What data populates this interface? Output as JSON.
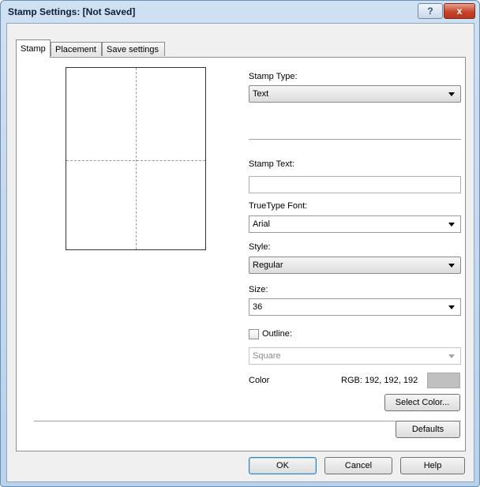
{
  "window": {
    "title": "Stamp Settings: [Not Saved]",
    "help_glyph": "?",
    "close_glyph": "x"
  },
  "tabs": [
    {
      "label": "Stamp",
      "active": true
    },
    {
      "label": "Placement",
      "active": false
    },
    {
      "label": "Save settings",
      "active": false
    }
  ],
  "stamp_type": {
    "label": "Stamp Type:",
    "value": "Text"
  },
  "stamp_text": {
    "label": "Stamp Text:",
    "value": ""
  },
  "font": {
    "label": "TrueType Font:",
    "value": "Arial"
  },
  "style": {
    "label": "Style:",
    "value": "Regular"
  },
  "size": {
    "label": "Size:",
    "value": "36"
  },
  "outline": {
    "label": "Outline:",
    "checked": false,
    "value": "Square"
  },
  "color": {
    "label": "Color",
    "rgb_text": "RGB: 192, 192, 192",
    "swatch": "#c0c0c0",
    "select_button": "Select Color..."
  },
  "defaults_button": "Defaults",
  "footer": {
    "ok": "OK",
    "cancel": "Cancel",
    "help": "Help"
  }
}
